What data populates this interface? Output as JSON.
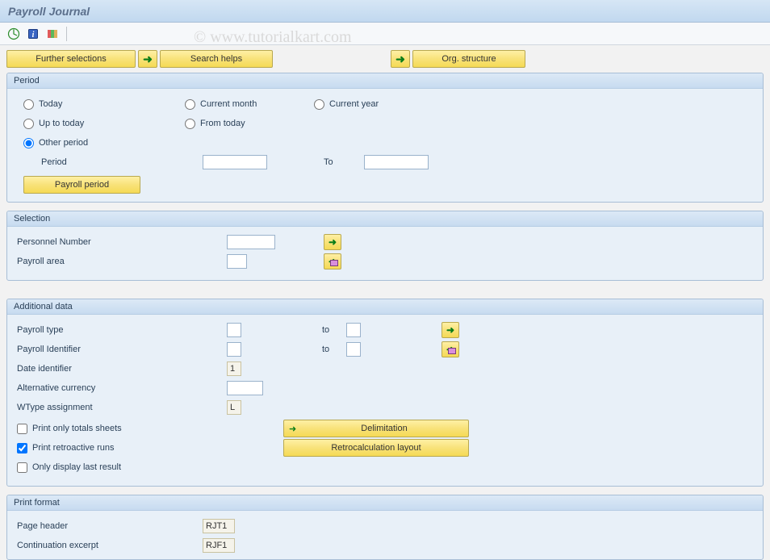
{
  "title": "Payroll Journal",
  "watermark": "© www.tutorialkart.com",
  "topButtons": {
    "furtherSelections": "Further selections",
    "searchHelps": "Search helps",
    "orgStructure": "Org. structure"
  },
  "period": {
    "header": "Period",
    "today": "Today",
    "currentMonth": "Current month",
    "currentYear": "Current year",
    "upToToday": "Up to today",
    "fromToday": "From today",
    "otherPeriod": "Other period",
    "periodLabel": "Period",
    "toLabel": "To",
    "periodFrom": "",
    "periodTo": "",
    "payrollPeriodBtn": "Payroll period"
  },
  "selection": {
    "header": "Selection",
    "personnelNumber": "Personnel Number",
    "personnelNumberVal": "",
    "payrollArea": "Payroll area",
    "payrollAreaVal": ""
  },
  "additional": {
    "header": "Additional data",
    "payrollType": "Payroll type",
    "payrollTypeFrom": "",
    "payrollTypeTo": "",
    "payrollIdentifier": "Payroll Identifier",
    "payrollIdentifierFrom": "",
    "payrollIdentifierTo": "",
    "dateIdentifier": "Date identifier",
    "dateIdentifierVal": "1",
    "altCurrency": "Alternative currency",
    "altCurrencyVal": "",
    "wtype": "WType assignment",
    "wtypeVal": "L",
    "toLabel": "to",
    "printTotals": "Print only totals sheets",
    "printRetro": "Print retroactive runs",
    "onlyLast": "Only display last result",
    "delimitation": "Delimitation",
    "retroLayout": "Retrocalculation layout"
  },
  "printFormat": {
    "header": "Print format",
    "pageHeader": "Page header",
    "pageHeaderVal": "RJT1",
    "contExcerpt": "Continuation excerpt",
    "contExcerptVal": "RJF1"
  }
}
